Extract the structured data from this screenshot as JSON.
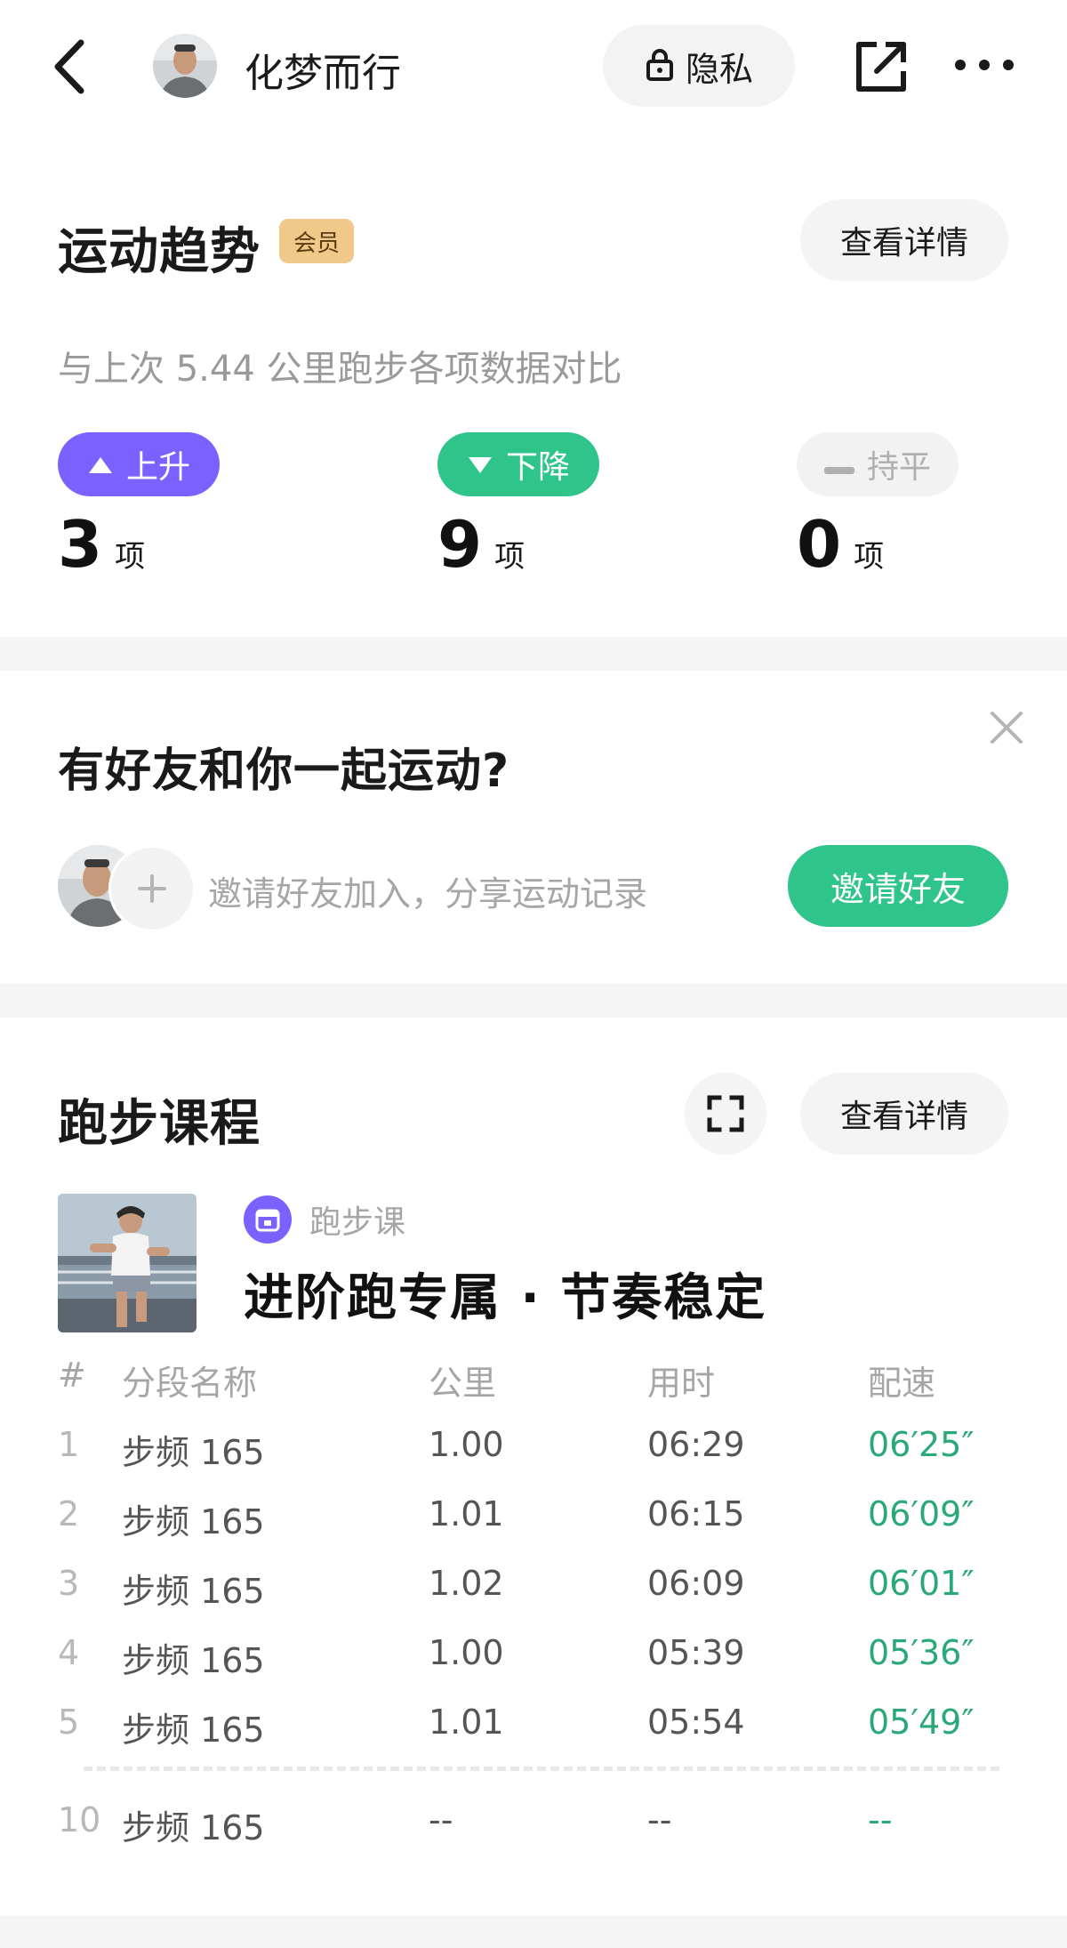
{
  "header": {
    "user_name": "化梦而行",
    "privacy_label": "隐私",
    "icons": [
      "back-icon",
      "lock-icon",
      "share-icon",
      "more-icon"
    ]
  },
  "trend": {
    "title": "运动趋势",
    "badge": "会员",
    "detail_label": "查看详情",
    "compare_text": "与上次 5.44 公里跑步各项数据对比",
    "up": {
      "label": "上升",
      "count": "3",
      "unit": "项"
    },
    "down": {
      "label": "下降",
      "count": "9",
      "unit": "项"
    },
    "flat": {
      "label": "持平",
      "count": "0",
      "unit": "项"
    },
    "colors": {
      "up": "#7b61ff",
      "down": "#2ec48a",
      "flat": "#f2f2f2"
    }
  },
  "friends": {
    "title": "有好友和你一起运动?",
    "invite_text": "邀请好友加入，分享运动记录",
    "invite_button": "邀请好友"
  },
  "course": {
    "title": "跑步课程",
    "detail_label": "查看详情",
    "tag": "跑步课",
    "name": "进阶跑专属 · 节奏稳定",
    "columns": {
      "idx": "#",
      "name": "分段名称",
      "km": "公里",
      "time": "用时",
      "pace": "配速"
    },
    "rows": [
      {
        "idx": "1",
        "name": "步频 165",
        "km": "1.00",
        "time": "06:29",
        "pace": "06′25″"
      },
      {
        "idx": "2",
        "name": "步频 165",
        "km": "1.01",
        "time": "06:15",
        "pace": "06′09″"
      },
      {
        "idx": "3",
        "name": "步频 165",
        "km": "1.02",
        "time": "06:09",
        "pace": "06′01″"
      },
      {
        "idx": "4",
        "name": "步频 165",
        "km": "1.00",
        "time": "05:39",
        "pace": "05′36″"
      },
      {
        "idx": "5",
        "name": "步频 165",
        "km": "1.01",
        "time": "05:54",
        "pace": "05′49″"
      }
    ],
    "last_row": {
      "idx": "10",
      "name": "步频 165",
      "km": "--",
      "time": "--",
      "pace": "--"
    },
    "accent": "#2aa878"
  }
}
